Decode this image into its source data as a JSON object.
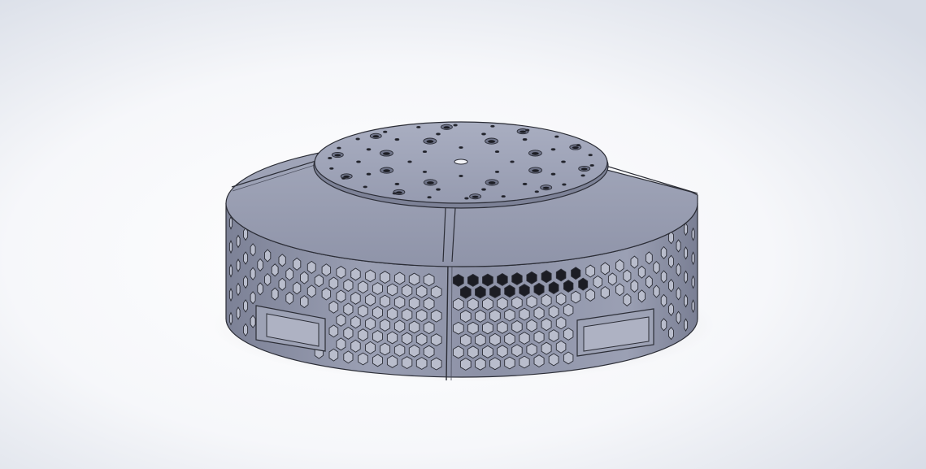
{
  "viewport": {
    "background_center": "#ffffff",
    "background_edge": "#d9dee8"
  },
  "model": {
    "name": "",
    "body_color": "#8e93a8",
    "body_light": "#9ea3b7",
    "body_dark": "#6b7086",
    "edge_color": "#2b2d36",
    "hole_color": "#1c1d24",
    "pattern": "hexagonal-mesh"
  }
}
